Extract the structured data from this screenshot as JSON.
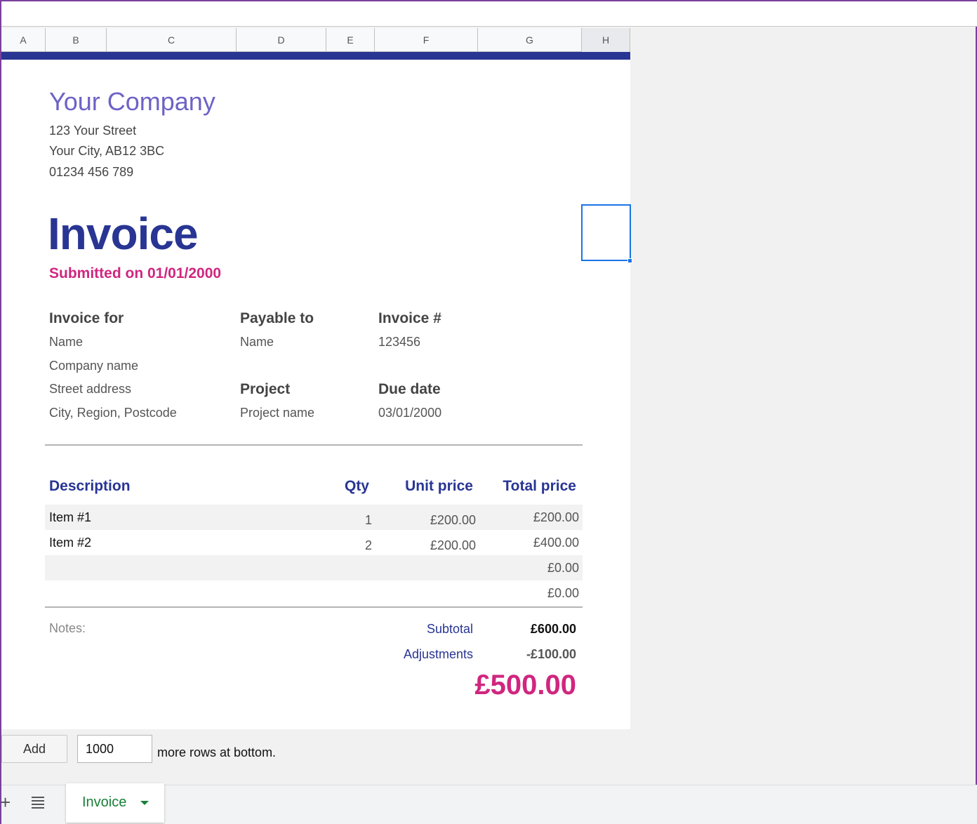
{
  "columns": [
    "A",
    "B",
    "C",
    "D",
    "E",
    "F",
    "G",
    "H"
  ],
  "company": {
    "name": "Your Company",
    "street": "123 Your Street",
    "city": "Your City, AB12 3BC",
    "phone": "01234 456 789"
  },
  "invoice": {
    "title": "Invoice",
    "submitted": "Submitted on 01/01/2000"
  },
  "invoice_for": {
    "label": "Invoice for",
    "name": "Name",
    "company": "Company name",
    "street": "Street address",
    "city": "City, Region, Postcode"
  },
  "payable_to": {
    "label": "Payable to",
    "name": "Name"
  },
  "invoice_number": {
    "label": "Invoice #",
    "value": "123456"
  },
  "project": {
    "label": "Project",
    "value": "Project name"
  },
  "due_date": {
    "label": "Due date",
    "value": "03/01/2000"
  },
  "table": {
    "headers": {
      "description": "Description",
      "qty": "Qty",
      "unit_price": "Unit price",
      "total_price": "Total price"
    },
    "rows": [
      {
        "description": "Item #1",
        "qty": "1",
        "unit_price": "£200.00",
        "total_price": "£200.00"
      },
      {
        "description": "Item #2",
        "qty": "2",
        "unit_price": "£200.00",
        "total_price": "£400.00"
      },
      {
        "description": "",
        "qty": "",
        "unit_price": "",
        "total_price": "£0.00"
      },
      {
        "description": "",
        "qty": "",
        "unit_price": "",
        "total_price": "£0.00"
      }
    ]
  },
  "notes_label": "Notes:",
  "summary": {
    "subtotal_label": "Subtotal",
    "subtotal_value": "£600.00",
    "adjustments_label": "Adjustments",
    "adjustments_value": "-£100.00",
    "grand_total": "£500.00"
  },
  "add_rows": {
    "button_label": "Add",
    "count": "1000",
    "suffix": "more rows at bottom."
  },
  "sheet_tab": {
    "label": "Invoice"
  },
  "icons": {
    "add_sheet": "plus-icon",
    "all_sheets": "menu-icon",
    "tab_menu": "caret-down-icon"
  },
  "colors": {
    "accent_navy": "#283593",
    "accent_magenta": "#d0267f",
    "company_purple": "#6d62c6",
    "tab_green": "#188038"
  }
}
